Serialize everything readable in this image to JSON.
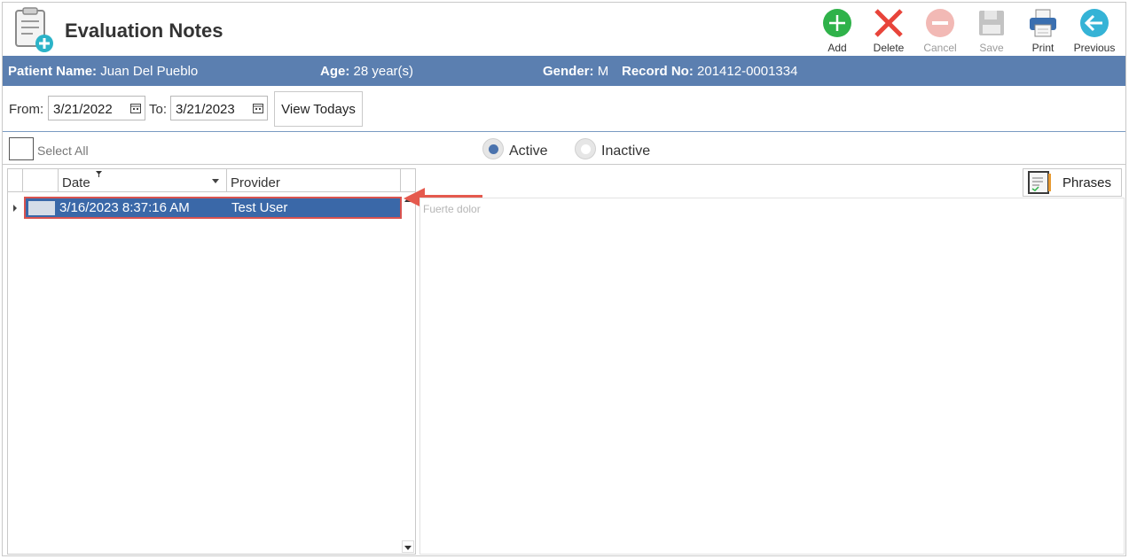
{
  "app": {
    "title": "Evaluation Notes"
  },
  "toolbar": {
    "add": "Add",
    "delete": "Delete",
    "cancel": "Cancel",
    "save": "Save",
    "print": "Print",
    "previous": "Previous"
  },
  "patient": {
    "name_label": "Patient Name:",
    "name": "Juan Del Pueblo",
    "age_label": "Age:",
    "age": "28 year(s)",
    "gender_label": "Gender:",
    "gender": "M",
    "record_label": "Record No:",
    "record": "201412-0001334"
  },
  "filter": {
    "from_label": "From:",
    "from_value": "3/21/2022",
    "to_label": "To:",
    "to_value": "3/21/2023",
    "view_todays": "View Todays"
  },
  "selection": {
    "select_all": "Select All",
    "active": "Active",
    "inactive": "Inactive",
    "selected": "Active"
  },
  "grid": {
    "columns": [
      "Date",
      "Provider"
    ],
    "rows": [
      {
        "date": "3/16/2023 8:37:16 AM",
        "provider": "Test User"
      }
    ]
  },
  "notes": {
    "phrases_label": "Phrases",
    "text": "Fuerte dolor"
  },
  "colors": {
    "patient_bar": "#5b7fb0",
    "selected_row": "#3a68a8",
    "callout": "#e55a4e",
    "add": "#2fb24a",
    "delete": "#e8443a",
    "previous": "#35b3d6"
  }
}
